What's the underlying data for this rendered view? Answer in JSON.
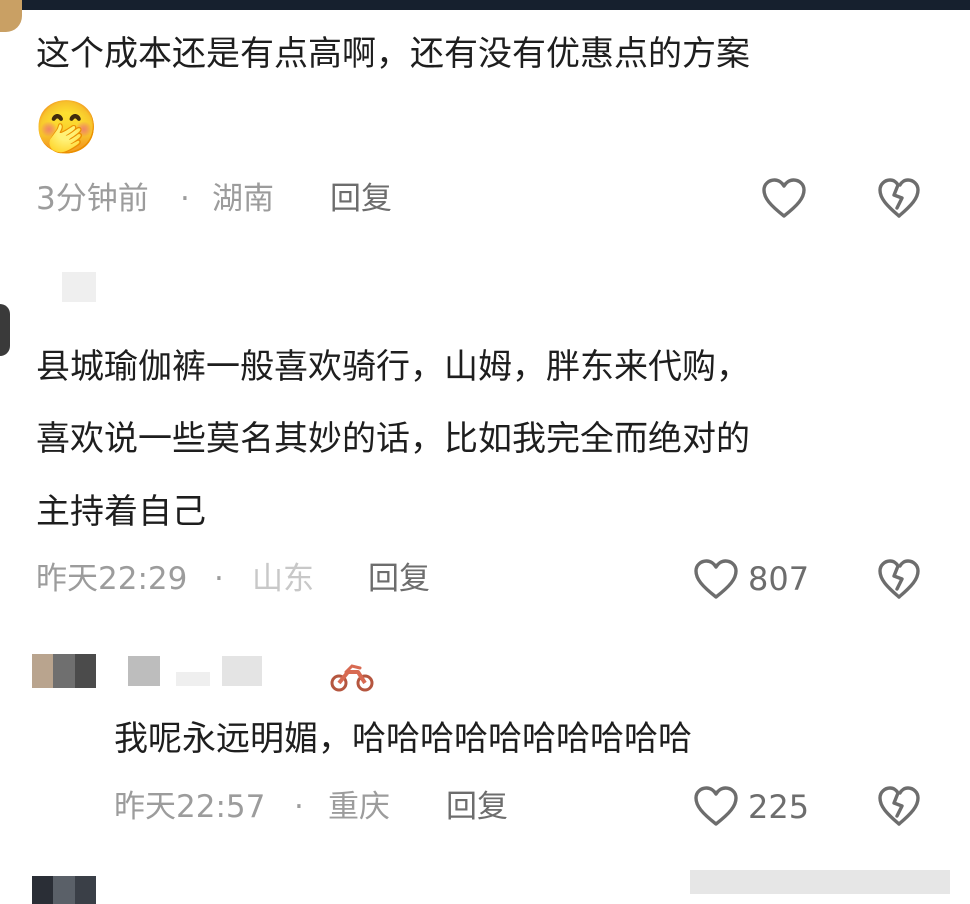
{
  "comments": [
    {
      "text": "这个成本还是有点高啊，还有没有优惠点的方案",
      "emoji": "🤭",
      "time": "3分钟前",
      "dot": "·",
      "location": "湖南",
      "reply_label": "回复",
      "like_count": ""
    },
    {
      "lines": [
        "县城瑜伽裤一般喜欢骑行，山姆，胖东来代购，",
        "喜欢说一些莫名其妙的话，比如我完全而绝对的",
        "主持着自己"
      ],
      "time": "昨天22:29",
      "dot": "·",
      "location": "山东",
      "reply_label": "回复",
      "like_count": "807"
    },
    {
      "text": "我呢永远明媚，哈哈哈哈哈哈哈哈哈哈",
      "time": "昨天22:57",
      "dot": "·",
      "location": "重庆",
      "reply_label": "回复",
      "like_count": "225"
    }
  ],
  "icons": {
    "like": "heart-outline-icon",
    "dislike": "broken-heart-icon",
    "badge": "motorcycle-icon"
  },
  "colors": {
    "text": "#1e1e1e",
    "meta": "#9c9c9c",
    "icon": "#6d6d6d",
    "topbar": "#16202e"
  }
}
